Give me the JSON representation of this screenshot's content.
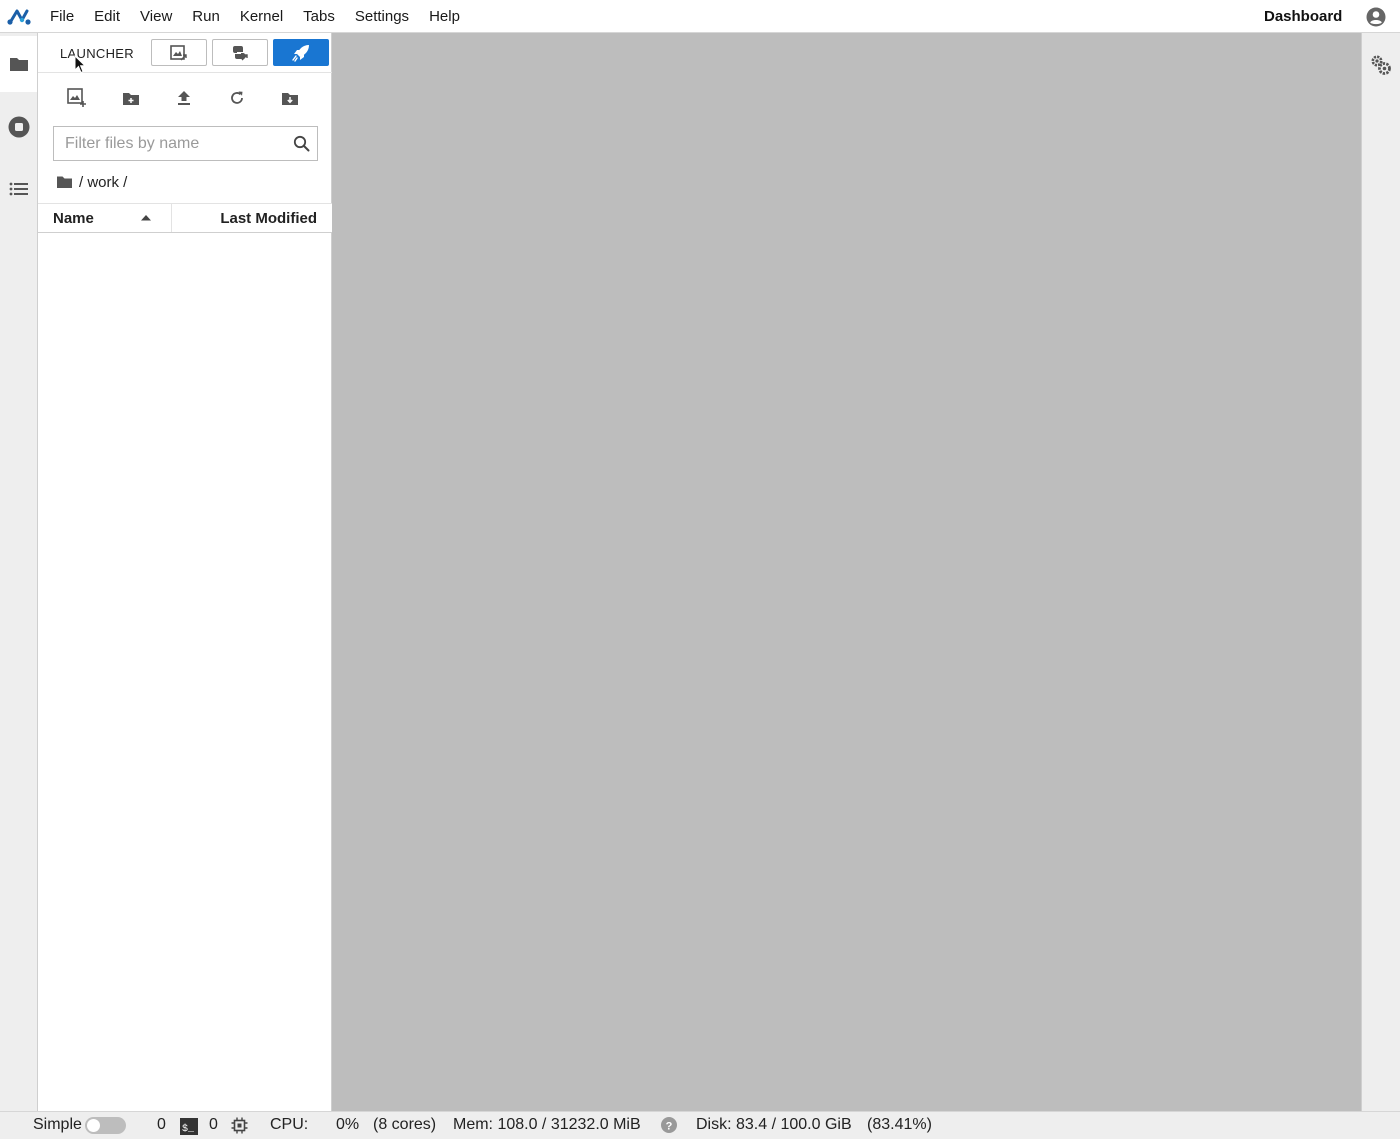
{
  "menubar": {
    "items": [
      {
        "label": "File"
      },
      {
        "label": "Edit"
      },
      {
        "label": "View"
      },
      {
        "label": "Run"
      },
      {
        "label": "Kernel"
      },
      {
        "label": "Tabs"
      },
      {
        "label": "Settings"
      },
      {
        "label": "Help"
      }
    ],
    "dashboard_label": "Dashboard"
  },
  "activitybar": {
    "items": [
      {
        "icon": "folder-icon"
      },
      {
        "icon": "stop-circle-icon"
      },
      {
        "icon": "list-icon"
      }
    ]
  },
  "launcher_tabs": {
    "label": "LAUNCHER",
    "buttons": [
      {
        "icon": "notebook-icon"
      },
      {
        "icon": "python-console-icon"
      },
      {
        "icon": "rocket-icon",
        "active": true
      }
    ]
  },
  "filebrowser": {
    "toolbar": [
      {
        "icon": "new-launcher-icon"
      },
      {
        "icon": "new-folder-icon"
      },
      {
        "icon": "upload-icon"
      },
      {
        "icon": "refresh-icon"
      },
      {
        "icon": "git-clone-icon"
      }
    ],
    "filter": {
      "placeholder": "Filter files by name",
      "value": ""
    },
    "breadcrumb": "/ work /",
    "columns": {
      "name": "Name",
      "modified": "Last Modified"
    },
    "sort": "ascending",
    "files": []
  },
  "statusbar": {
    "simple_label": "Simple",
    "simple_enabled": false,
    "kernel_count": "0",
    "terminal_count": "0",
    "cpu_label": "CPU:",
    "cpu_value": "0%",
    "cpu_cores": "(8 cores)",
    "mem": "Mem: 108.0 / 31232.0 MiB",
    "disk": "Disk: 83.4 / 100.0 GiB",
    "disk_percent": "(83.41%)"
  },
  "colors": {
    "accent": "#1976d2",
    "main_bg": "#bdbdbd",
    "panel_bg": "#ffffff",
    "chrome_bg": "#eeeeee"
  }
}
